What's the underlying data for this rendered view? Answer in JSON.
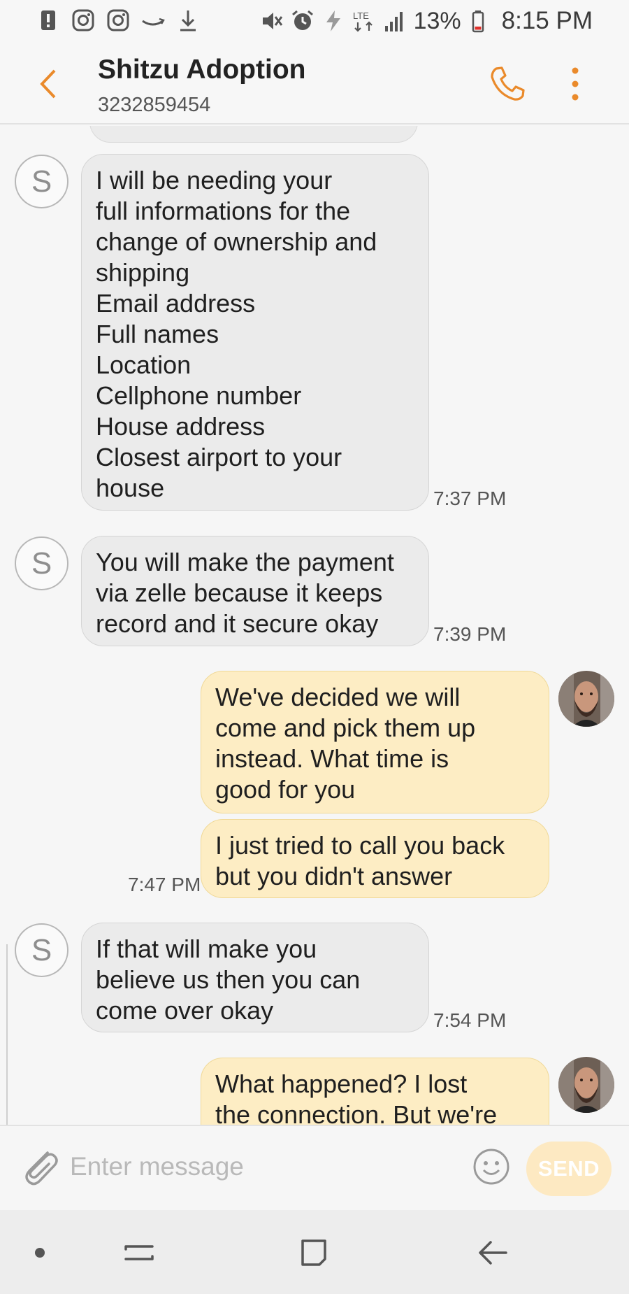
{
  "status_bar": {
    "battery_percent": "13%",
    "time": "8:15 PM",
    "network": "LTE",
    "icons_left": [
      "alert-icon",
      "instagram-icon",
      "instagram-icon",
      "amazon-icon",
      "download-icon"
    ],
    "icons_right": [
      "mute-icon",
      "alarm-icon",
      "flash-icon",
      "lte-icon",
      "signal-icon",
      "battery-icon"
    ]
  },
  "header": {
    "contact_name": "Shitzu Adoption",
    "contact_number": "3232859454"
  },
  "messages": [
    {
      "direction": "in",
      "avatar_letter": "S",
      "text": "I will be needing your\nfull informations for the\nchange of ownership and\nshipping\nEmail address\nFull names\nLocation\nCellphone number\nHouse address\nClosest airport to your\nhouse",
      "time": "7:37 PM"
    },
    {
      "direction": "in",
      "avatar_letter": "S",
      "text": "You will make the payment\nvia zelle because it keeps\nrecord and it secure okay",
      "time": "7:39 PM"
    },
    {
      "direction": "out",
      "text": "We've decided we will\ncome and pick them up\ninstead. What time is\ngood for you",
      "time": ""
    },
    {
      "direction": "out",
      "text": "I just tried to call you back\nbut you didn't answer",
      "time": "7:47 PM"
    },
    {
      "direction": "in",
      "avatar_letter": "S",
      "text": "If that will make you\nbelieve us then you can\ncome over okay",
      "time": "7:54 PM"
    },
    {
      "direction": "out",
      "text": "What happened? I lost\nthe connection. But we're",
      "time": ""
    }
  ],
  "composer": {
    "placeholder": "Enter message",
    "value": "",
    "send_label": "SEND"
  },
  "colors": {
    "accent": "#ea8a2b",
    "incoming_bubble": "#ebebeb",
    "outgoing_bubble": "#fdedc4",
    "send_button": "#fde9c2"
  }
}
